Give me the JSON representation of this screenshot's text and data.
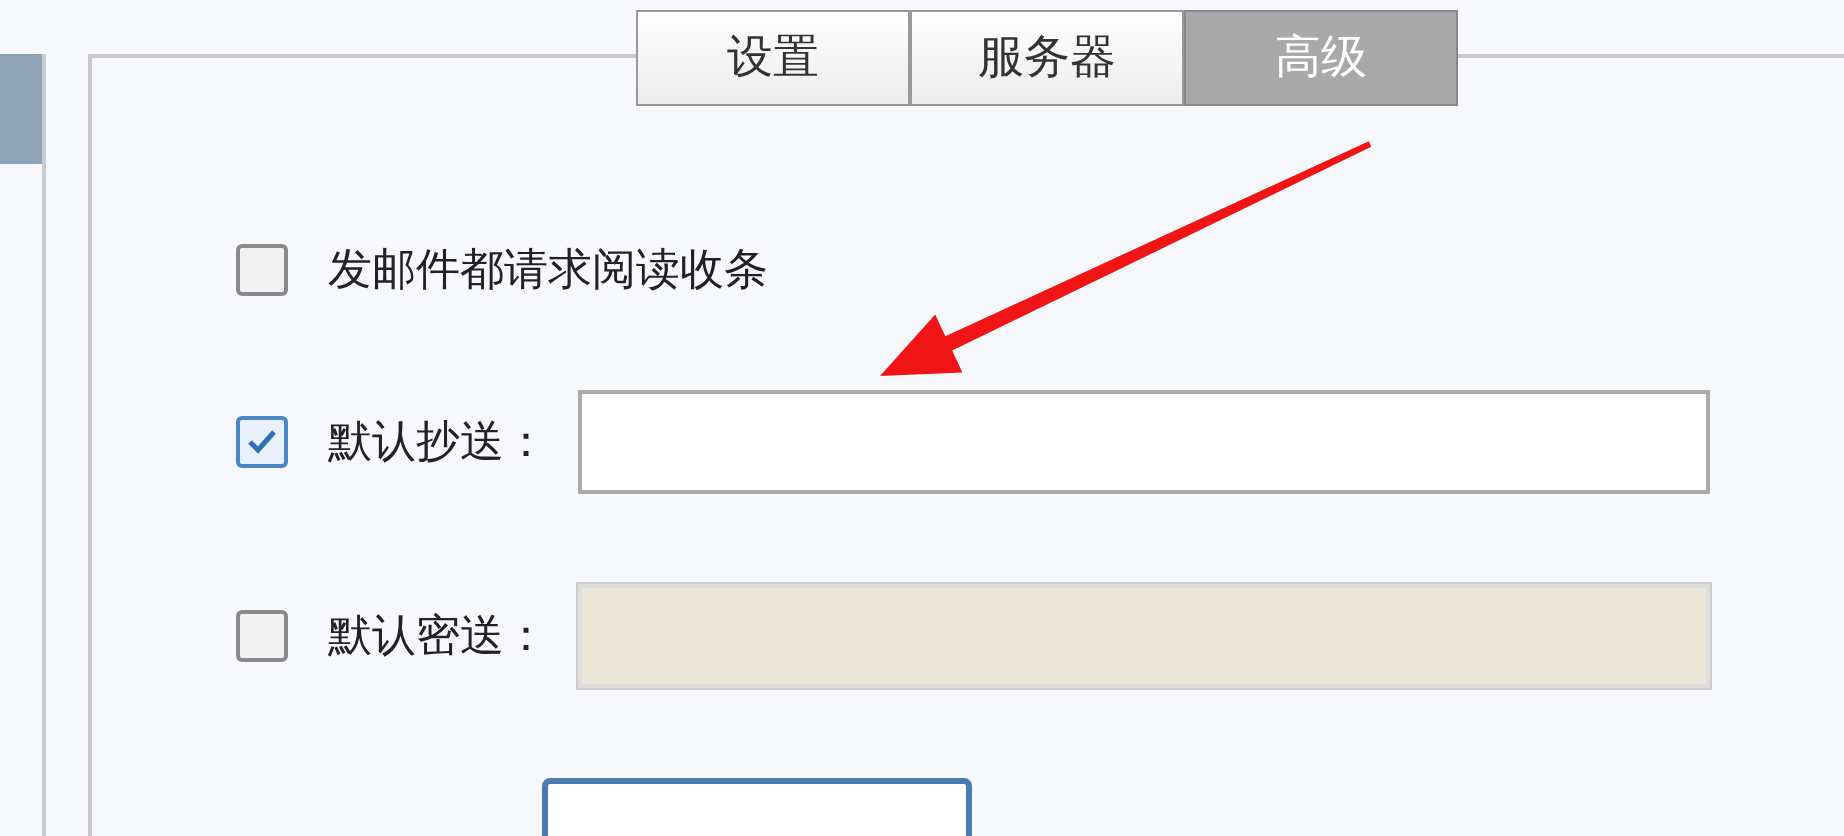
{
  "tabs": [
    {
      "label": "设置",
      "selected": false
    },
    {
      "label": "服务器",
      "selected": false
    },
    {
      "label": "高级",
      "selected": true
    }
  ],
  "options": [
    {
      "kind": "checkbox",
      "label": "发邮件都请求阅读收条",
      "checked": false
    },
    {
      "kind": "field",
      "label": "默认抄送：",
      "checked": true,
      "disabled": false
    },
    {
      "kind": "field",
      "label": "默认密送：",
      "checked": false,
      "disabled": true
    }
  ]
}
